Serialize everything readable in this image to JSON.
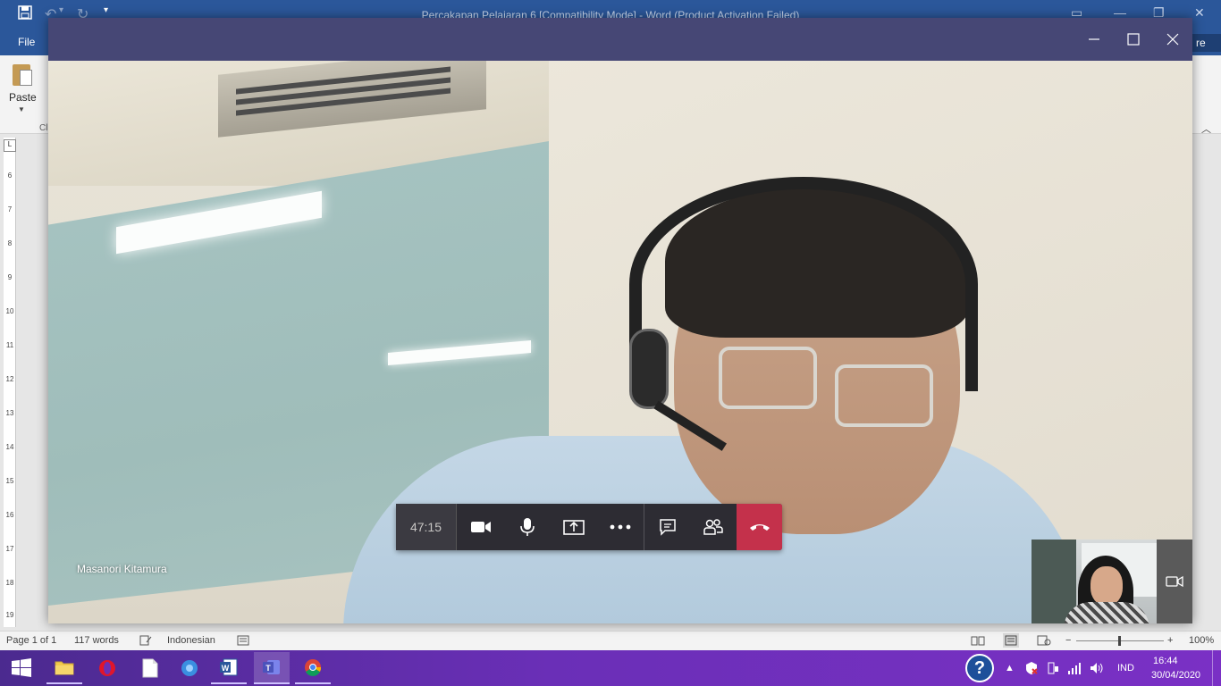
{
  "word": {
    "title": "Percakapan Pelajaran 6 [Compatibility Mode] - Word (Product Activation Failed)",
    "file_tab": "File",
    "share_label": "re",
    "paste_label": "Paste",
    "clipboard_group": "Cl",
    "ruler_ticks": [
      "6",
      "7",
      "8",
      "9",
      "10",
      "11",
      "12",
      "13",
      "14",
      "15",
      "16",
      "17",
      "18",
      "19"
    ],
    "status": {
      "page": "Page 1 of 1",
      "words": "117 words",
      "language": "Indonesian",
      "zoom": "100%"
    }
  },
  "call": {
    "timer": "47:15",
    "participant_name": "Masanori Kitamura",
    "controls": [
      {
        "name": "camera-button",
        "icon": "video-camera-icon"
      },
      {
        "name": "microphone-button",
        "icon": "microphone-icon"
      },
      {
        "name": "share-screen-button",
        "icon": "share-tray-icon"
      },
      {
        "name": "more-actions-button",
        "icon": "ellipsis-icon"
      },
      {
        "name": "chat-button",
        "icon": "chat-icon"
      },
      {
        "name": "participants-button",
        "icon": "people-icon"
      }
    ],
    "hangup_color": "#c4314b",
    "titlebar_color": "#464775"
  },
  "taskbar": {
    "language": "IND",
    "time": "16:44",
    "date": "30/04/2020",
    "accent": "#6a2fb7"
  }
}
